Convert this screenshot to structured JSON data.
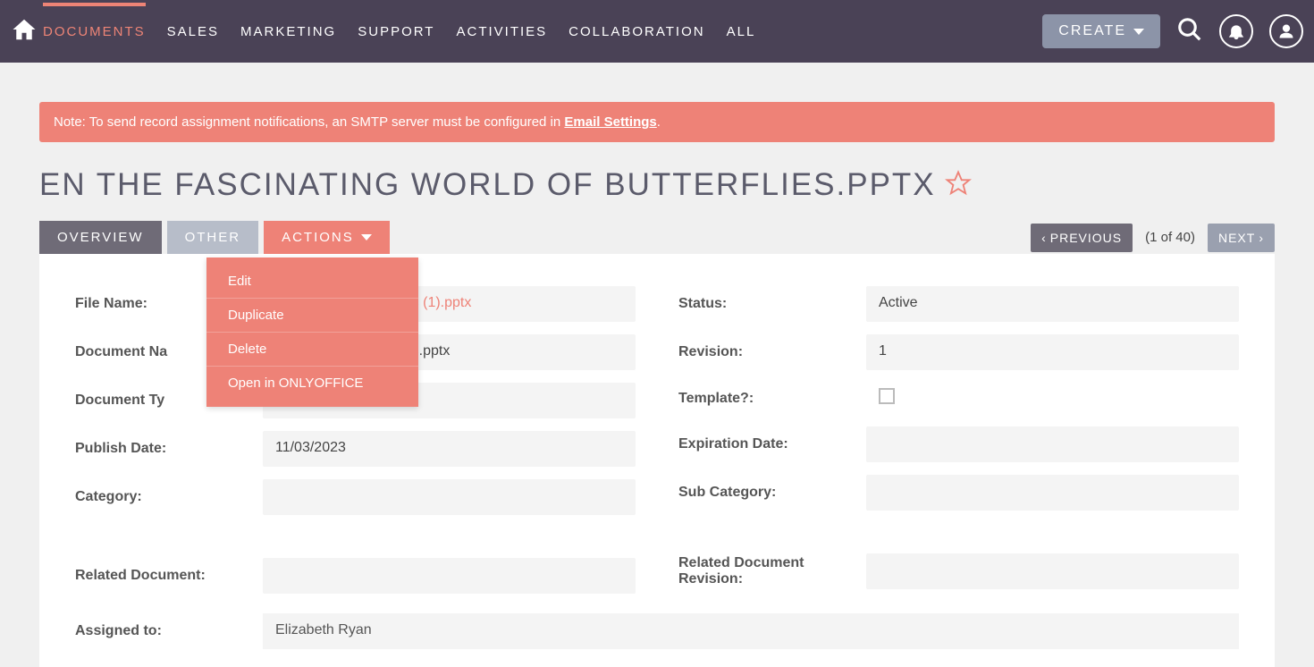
{
  "nav": {
    "items": [
      "DOCUMENTS",
      "SALES",
      "MARKETING",
      "SUPPORT",
      "ACTIVITIES",
      "COLLABORATION",
      "ALL"
    ],
    "create": "CREATE"
  },
  "alert": {
    "prefix": "Note: To send record assignment notifications, an SMTP server must be configured in ",
    "link": "Email Settings",
    "suffix": "."
  },
  "title": "EN THE FASCINATING WORLD OF BUTTERFLIES.PPTX",
  "tabs": {
    "overview": "OVERVIEW",
    "other": "OTHER",
    "actions": "ACTIONS"
  },
  "actions_menu": [
    "Edit",
    "Duplicate",
    "Delete",
    "Open in ONLYOFFICE"
  ],
  "pager": {
    "previous": "PREVIOUS",
    "count": "(1 of 40)",
    "next": "NEXT"
  },
  "fields": {
    "left": {
      "file_name": {
        "label": "File Name:",
        "value": "ing World of Butterflies (1).pptx"
      },
      "document_name": {
        "label": "Document Na",
        "value": "ing World of Butterflies.pptx"
      },
      "document_type": {
        "label": "Document Ty",
        "value": ""
      },
      "publish_date": {
        "label": "Publish Date:",
        "value": "11/03/2023"
      },
      "category": {
        "label": "Category:",
        "value": ""
      },
      "related_document": {
        "label": "Related Document:",
        "value": ""
      }
    },
    "right": {
      "status": {
        "label": "Status:",
        "value": "Active"
      },
      "revision": {
        "label": "Revision:",
        "value": "1"
      },
      "template": {
        "label": "Template?:",
        "checked": false
      },
      "expiration_date": {
        "label": "Expiration Date:",
        "value": ""
      },
      "sub_category": {
        "label": "Sub Category:",
        "value": ""
      },
      "related_document_revision": {
        "label": "Related Document Revision:",
        "value": ""
      }
    },
    "assigned_to": {
      "label": "Assigned to:",
      "value": "Elizabeth Ryan"
    }
  }
}
